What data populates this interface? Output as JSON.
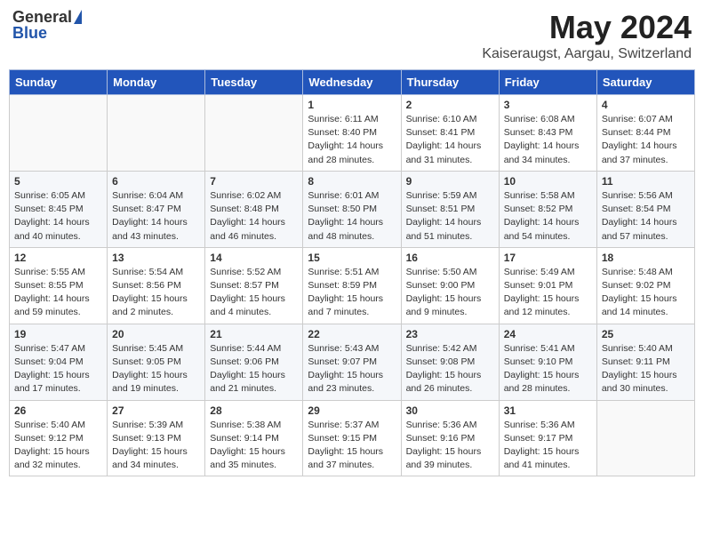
{
  "header": {
    "logo_general": "General",
    "logo_blue": "Blue",
    "month_title": "May 2024",
    "location": "Kaiseraugst, Aargau, Switzerland"
  },
  "days_of_week": [
    "Sunday",
    "Monday",
    "Tuesday",
    "Wednesday",
    "Thursday",
    "Friday",
    "Saturday"
  ],
  "weeks": [
    [
      {
        "day": "",
        "info": ""
      },
      {
        "day": "",
        "info": ""
      },
      {
        "day": "",
        "info": ""
      },
      {
        "day": "1",
        "info": "Sunrise: 6:11 AM\nSunset: 8:40 PM\nDaylight: 14 hours and 28 minutes."
      },
      {
        "day": "2",
        "info": "Sunrise: 6:10 AM\nSunset: 8:41 PM\nDaylight: 14 hours and 31 minutes."
      },
      {
        "day": "3",
        "info": "Sunrise: 6:08 AM\nSunset: 8:43 PM\nDaylight: 14 hours and 34 minutes."
      },
      {
        "day": "4",
        "info": "Sunrise: 6:07 AM\nSunset: 8:44 PM\nDaylight: 14 hours and 37 minutes."
      }
    ],
    [
      {
        "day": "5",
        "info": "Sunrise: 6:05 AM\nSunset: 8:45 PM\nDaylight: 14 hours and 40 minutes."
      },
      {
        "day": "6",
        "info": "Sunrise: 6:04 AM\nSunset: 8:47 PM\nDaylight: 14 hours and 43 minutes."
      },
      {
        "day": "7",
        "info": "Sunrise: 6:02 AM\nSunset: 8:48 PM\nDaylight: 14 hours and 46 minutes."
      },
      {
        "day": "8",
        "info": "Sunrise: 6:01 AM\nSunset: 8:50 PM\nDaylight: 14 hours and 48 minutes."
      },
      {
        "day": "9",
        "info": "Sunrise: 5:59 AM\nSunset: 8:51 PM\nDaylight: 14 hours and 51 minutes."
      },
      {
        "day": "10",
        "info": "Sunrise: 5:58 AM\nSunset: 8:52 PM\nDaylight: 14 hours and 54 minutes."
      },
      {
        "day": "11",
        "info": "Sunrise: 5:56 AM\nSunset: 8:54 PM\nDaylight: 14 hours and 57 minutes."
      }
    ],
    [
      {
        "day": "12",
        "info": "Sunrise: 5:55 AM\nSunset: 8:55 PM\nDaylight: 14 hours and 59 minutes."
      },
      {
        "day": "13",
        "info": "Sunrise: 5:54 AM\nSunset: 8:56 PM\nDaylight: 15 hours and 2 minutes."
      },
      {
        "day": "14",
        "info": "Sunrise: 5:52 AM\nSunset: 8:57 PM\nDaylight: 15 hours and 4 minutes."
      },
      {
        "day": "15",
        "info": "Sunrise: 5:51 AM\nSunset: 8:59 PM\nDaylight: 15 hours and 7 minutes."
      },
      {
        "day": "16",
        "info": "Sunrise: 5:50 AM\nSunset: 9:00 PM\nDaylight: 15 hours and 9 minutes."
      },
      {
        "day": "17",
        "info": "Sunrise: 5:49 AM\nSunset: 9:01 PM\nDaylight: 15 hours and 12 minutes."
      },
      {
        "day": "18",
        "info": "Sunrise: 5:48 AM\nSunset: 9:02 PM\nDaylight: 15 hours and 14 minutes."
      }
    ],
    [
      {
        "day": "19",
        "info": "Sunrise: 5:47 AM\nSunset: 9:04 PM\nDaylight: 15 hours and 17 minutes."
      },
      {
        "day": "20",
        "info": "Sunrise: 5:45 AM\nSunset: 9:05 PM\nDaylight: 15 hours and 19 minutes."
      },
      {
        "day": "21",
        "info": "Sunrise: 5:44 AM\nSunset: 9:06 PM\nDaylight: 15 hours and 21 minutes."
      },
      {
        "day": "22",
        "info": "Sunrise: 5:43 AM\nSunset: 9:07 PM\nDaylight: 15 hours and 23 minutes."
      },
      {
        "day": "23",
        "info": "Sunrise: 5:42 AM\nSunset: 9:08 PM\nDaylight: 15 hours and 26 minutes."
      },
      {
        "day": "24",
        "info": "Sunrise: 5:41 AM\nSunset: 9:10 PM\nDaylight: 15 hours and 28 minutes."
      },
      {
        "day": "25",
        "info": "Sunrise: 5:40 AM\nSunset: 9:11 PM\nDaylight: 15 hours and 30 minutes."
      }
    ],
    [
      {
        "day": "26",
        "info": "Sunrise: 5:40 AM\nSunset: 9:12 PM\nDaylight: 15 hours and 32 minutes."
      },
      {
        "day": "27",
        "info": "Sunrise: 5:39 AM\nSunset: 9:13 PM\nDaylight: 15 hours and 34 minutes."
      },
      {
        "day": "28",
        "info": "Sunrise: 5:38 AM\nSunset: 9:14 PM\nDaylight: 15 hours and 35 minutes."
      },
      {
        "day": "29",
        "info": "Sunrise: 5:37 AM\nSunset: 9:15 PM\nDaylight: 15 hours and 37 minutes."
      },
      {
        "day": "30",
        "info": "Sunrise: 5:36 AM\nSunset: 9:16 PM\nDaylight: 15 hours and 39 minutes."
      },
      {
        "day": "31",
        "info": "Sunrise: 5:36 AM\nSunset: 9:17 PM\nDaylight: 15 hours and 41 minutes."
      },
      {
        "day": "",
        "info": ""
      }
    ]
  ]
}
